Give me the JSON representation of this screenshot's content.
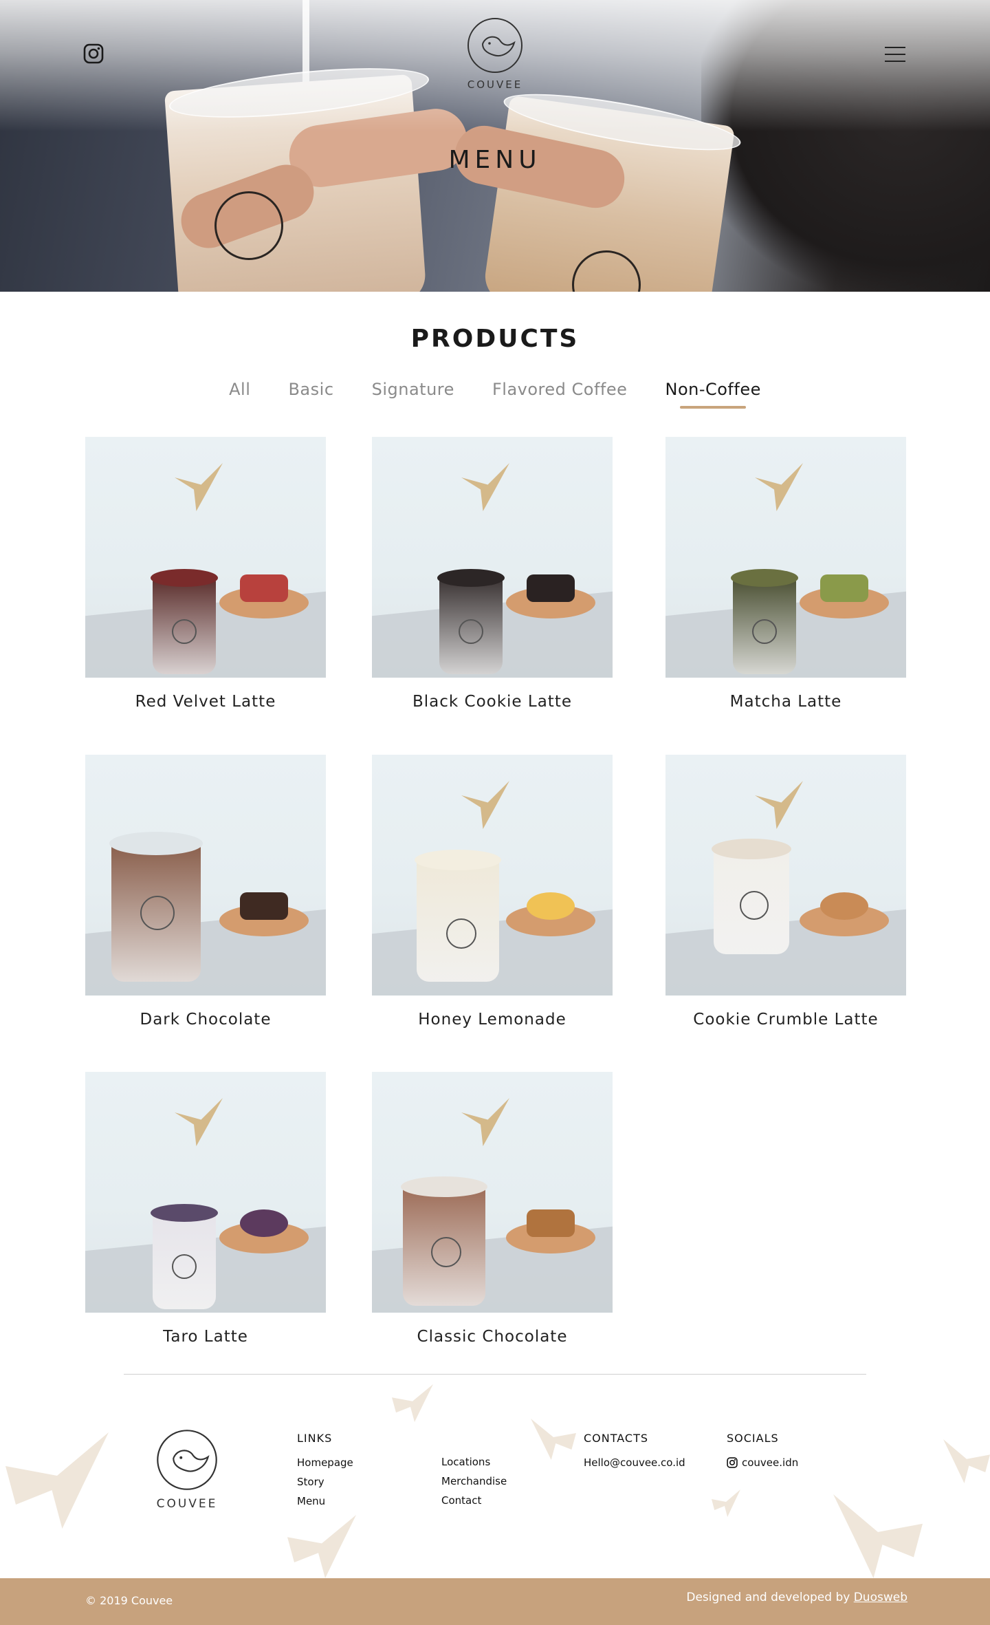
{
  "brand": {
    "name": "COUVEE"
  },
  "header": {
    "title": "MENU",
    "icons": {
      "instagram": "instagram-icon",
      "menu": "hamburger-menu-icon"
    }
  },
  "products": {
    "title": "PRODUCTS",
    "tabs": [
      {
        "label": "All",
        "active": false
      },
      {
        "label": "Basic",
        "active": false
      },
      {
        "label": "Signature",
        "active": false
      },
      {
        "label": "Flavored Coffee",
        "active": false
      },
      {
        "label": "Non-Coffee",
        "active": true
      }
    ],
    "items": [
      {
        "name": "Red Velvet Latte",
        "drink": "#5b2e2c",
        "topping": "#7a2b2b",
        "snack": "#b8413d"
      },
      {
        "name": "Black Cookie Latte",
        "drink": "#3a3333",
        "topping": "#2c2626",
        "snack": "#2a2222"
      },
      {
        "name": "Matcha Latte",
        "drink": "#4b5033",
        "topping": "#6a7040",
        "snack": "#8a9a4a"
      },
      {
        "name": "Dark Chocolate",
        "drink": "#8a5f4c",
        "topping": "#dfe5e8",
        "snack": "#3f2a22"
      },
      {
        "name": "Honey Lemonade",
        "drink": "#efe9d9",
        "topping": "#f3eee0",
        "snack": "#f0c255"
      },
      {
        "name": "Cookie Crumble Latte",
        "drink": "#f1efea",
        "topping": "#e6ddd0",
        "snack": "#c98b56"
      },
      {
        "name": "Taro Latte",
        "drink": "#e6e4ea",
        "topping": "#5a4a6a",
        "snack": "#5c3a5e"
      },
      {
        "name": "Classic Chocolate",
        "drink": "#9c6b56",
        "topping": "#e7e2dc",
        "snack": "#b0733e"
      }
    ]
  },
  "footer": {
    "links": {
      "heading": "LINKS",
      "items": [
        "Homepage",
        "Story",
        "Menu",
        "Locations",
        "Merchandise",
        "Contact"
      ]
    },
    "contacts": {
      "heading": "CONTACTS",
      "email": "Hello@couvee.co.id"
    },
    "socials": {
      "heading": "SOCIALS",
      "instagram": "couvee.idn"
    },
    "copyright": "© 2019 Couvee",
    "credit_prefix": "Designed and developed by",
    "credit_link": "Duosweb",
    "accent": "#c7a27d"
  }
}
